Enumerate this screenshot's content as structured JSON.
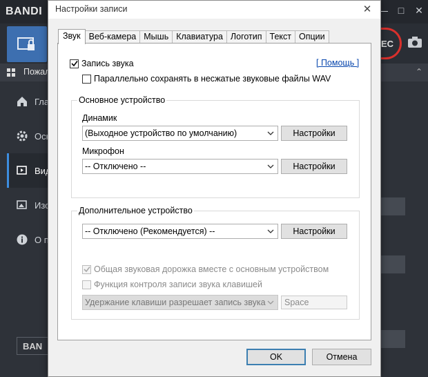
{
  "background_app": {
    "logo": "BANDI",
    "rec_label": "EC",
    "menu_label": "Пожал",
    "sidebar": [
      {
        "label": "Глав",
        "icon": "home-icon"
      },
      {
        "label": "Осн",
        "icon": "gear-icon"
      },
      {
        "label": "Вид",
        "icon": "video-gear-icon"
      },
      {
        "label": "Изо",
        "icon": "image-gear-icon"
      },
      {
        "label": "О пр",
        "icon": "info-icon"
      }
    ],
    "bottom_box": "BAN"
  },
  "dialog": {
    "title": "Настройки записи",
    "tabs": [
      "Звук",
      "Веб-камера",
      "Мышь",
      "Клавиатура",
      "Логотип",
      "Текст",
      "Опции"
    ],
    "active_tab": "Звук",
    "record_sound": {
      "label": "Запись звука",
      "checked": true
    },
    "help_link": "[ Помощь ]",
    "save_wav": {
      "label": "Параллельно сохранять в несжатые звуковые файлы WAV",
      "checked": false
    },
    "primary_device": {
      "title": "Основное устройство",
      "speaker_label": "Динамик",
      "speaker_value": "(Выходное устройство по умолчанию)",
      "speaker_settings": "Настройки",
      "mic_label": "Микрофон",
      "mic_value": "-- Отключено --",
      "mic_settings": "Настройки"
    },
    "secondary_device": {
      "title": "Дополнительное устройство",
      "device_value": "-- Отключено (Рекомендуется) --",
      "device_settings": "Настройки",
      "mix_track": {
        "label": "Общая звуковая дорожка вместе с основным устройством",
        "checked": true,
        "disabled": true
      },
      "hotkey_control": {
        "label": "Функция контроля записи звука клавишей",
        "checked": false,
        "disabled": true
      },
      "hotkey_mode_value": "Удержание клавиши разрешает запись звука",
      "hotkey_key_value": "Space"
    },
    "ok_label": "OK",
    "cancel_label": "Отмена"
  }
}
